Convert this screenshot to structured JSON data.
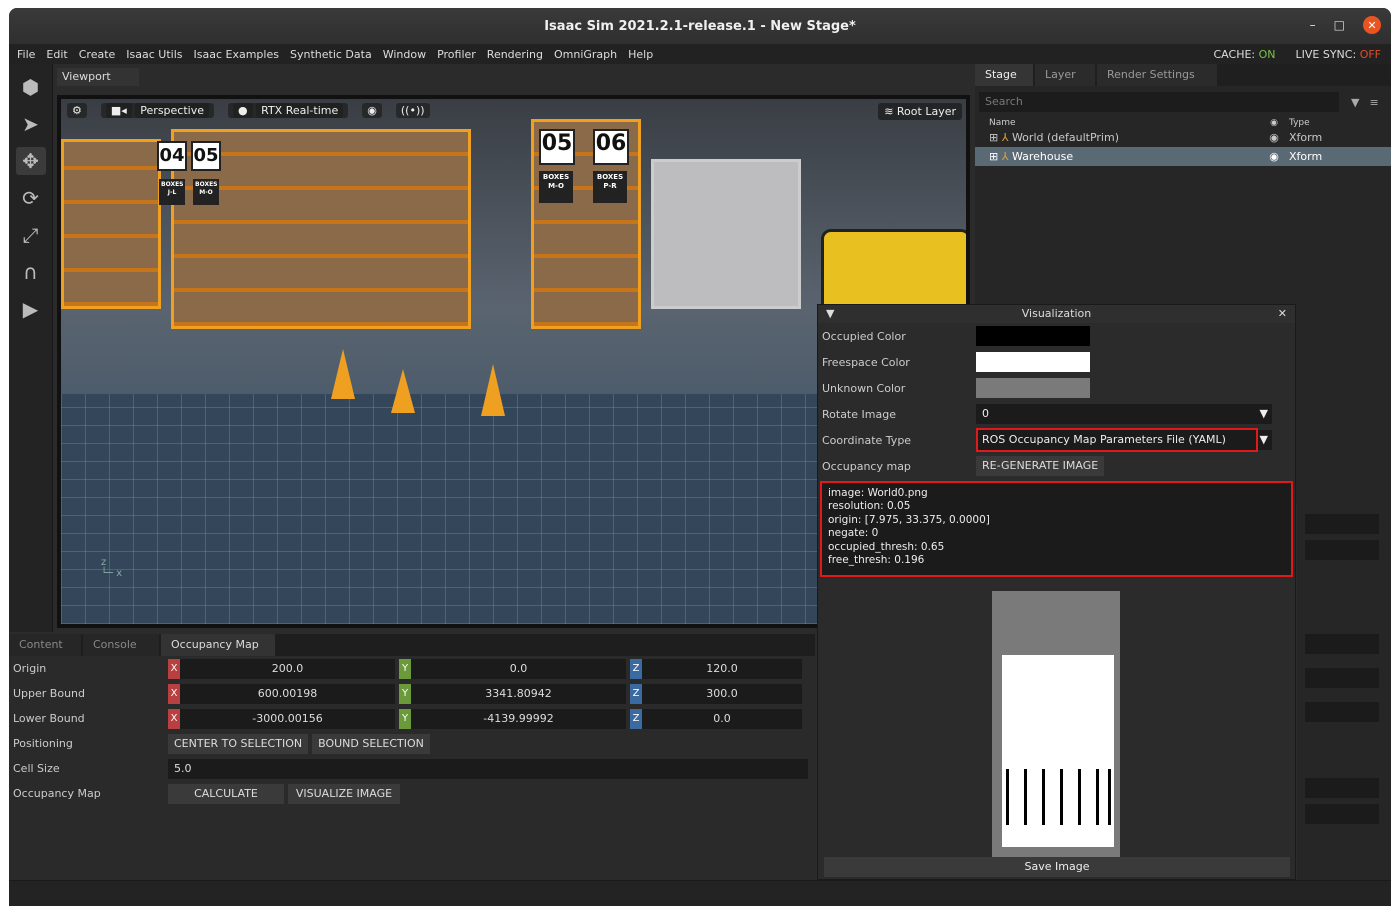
{
  "window": {
    "title": "Isaac Sim 2021.2.1-release.1 - New Stage*",
    "min": "–",
    "max": "□",
    "close": "✕"
  },
  "menu": {
    "items": [
      "File",
      "Edit",
      "Create",
      "Isaac Utils",
      "Isaac Examples",
      "Synthetic Data",
      "Window",
      "Profiler",
      "Rendering",
      "OmniGraph",
      "Help"
    ],
    "cache_label": "CACHE:",
    "cache_value": "ON",
    "livesync_label": "LIVE SYNC:",
    "livesync_value": "OFF"
  },
  "viewport": {
    "tab": "Viewport",
    "camera": "Perspective",
    "renderer": "RTX Real-time",
    "root_layer": "Root Layer",
    "signs": [
      "04",
      "05",
      "05",
      "06"
    ],
    "sign_subs": [
      "BOXES J-L",
      "BOXES M-O",
      "BOXES M-O",
      "BOXES P-R"
    ]
  },
  "stage": {
    "tabs": [
      "Stage",
      "Layer",
      "Render Settings"
    ],
    "search_placeholder": "Search",
    "columns": {
      "name": "Name",
      "type": "Type"
    },
    "rows": [
      {
        "name": "World (defaultPrim)",
        "type": "Xform"
      },
      {
        "name": "Warehouse",
        "type": "Xform"
      }
    ]
  },
  "bottom": {
    "tabs": [
      "Content",
      "Console",
      "Occupancy Map"
    ],
    "origin_label": "Origin",
    "origin": [
      "200.0",
      "0.0",
      "120.0"
    ],
    "upper_label": "Upper Bound",
    "upper": [
      "600.00198",
      "3341.80942",
      "300.0"
    ],
    "lower_label": "Lower Bound",
    "lower": [
      "-3000.00156",
      "-4139.99992",
      "0.0"
    ],
    "positioning_label": "Positioning",
    "center_btn": "CENTER TO SELECTION",
    "bound_btn": "BOUND SELECTION",
    "cellsize_label": "Cell Size",
    "cellsize": "5.0",
    "occmap_label": "Occupancy Map",
    "calculate_btn": "CALCULATE",
    "visualize_btn": "VISUALIZE IMAGE",
    "axes": [
      "X",
      "Y",
      "Z"
    ]
  },
  "viz": {
    "title": "Visualization",
    "occupied_label": "Occupied Color",
    "freespace_label": "Freespace Color",
    "unknown_label": "Unknown Color",
    "rotate_label": "Rotate Image",
    "rotate_value": "0",
    "coord_label": "Coordinate Type",
    "coord_value": "ROS Occupancy Map Parameters File (YAML)",
    "occmap_label": "Occupancy map",
    "regen_btn": "RE-GENERATE IMAGE",
    "yaml": "image: World0.png\nresolution: 0.05\norigin: [7.975, 33.375, 0.0000]\nnegate: 0\noccupied_thresh: 0.65\nfree_thresh: 0.196",
    "save_btn": "Save Image",
    "colors": {
      "occupied": "#000000",
      "freespace": "#ffffff",
      "unknown": "#7a7a7a"
    }
  }
}
